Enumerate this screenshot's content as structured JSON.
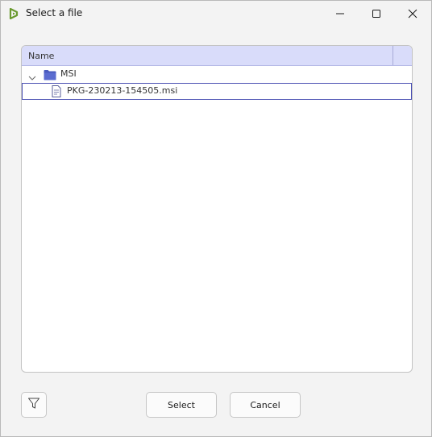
{
  "window": {
    "title": "Select a file",
    "controls": [
      "minimize-icon",
      "maximize-icon",
      "close-icon"
    ]
  },
  "tree": {
    "header": {
      "name": "Name"
    },
    "folder": {
      "label": "MSI",
      "expanded": true,
      "icon": "folder-icon"
    },
    "files": [
      {
        "label": "PKG-230213-154505.msi",
        "icon": "file-icon",
        "selected": true
      }
    ]
  },
  "footer": {
    "filter_icon": "filter-icon",
    "select_label": "Select",
    "cancel_label": "Cancel"
  },
  "colors": {
    "header_bg": "#d9dcfa",
    "folder_blue": "#4a5bbf",
    "selection_border": "#4a4fb3",
    "app_icon_green": "#6a9a2f"
  }
}
